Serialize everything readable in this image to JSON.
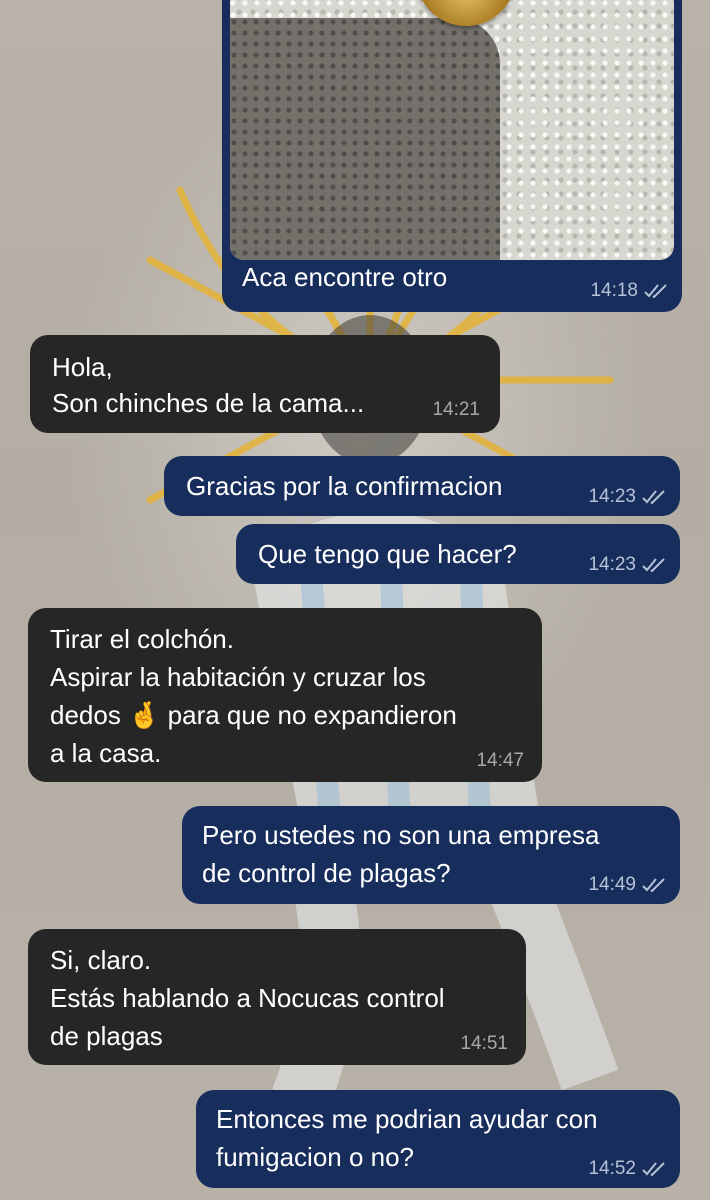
{
  "messages": [
    {
      "text": "Hola,\nSon chinches de la cama...",
      "time": "14:21"
    },
    {
      "text": "Gracias por la confirmacion",
      "time": "14:23"
    },
    {
      "text": "Que tengo que hacer?",
      "time": "14:23"
    },
    {
      "text": "Tirar el colchón.\nAspirar la habitación y cruzar los\ndedos 🤞 para que no expandieron\na la casa.",
      "time": "14:47"
    },
    {
      "text": "Pero ustedes no son una empresa\nde control de plagas?",
      "time": "14:49"
    },
    {
      "text": "Si, claro.\nEstás hablando a Nocucas control\nde plagas",
      "time": "14:51"
    },
    {
      "text": "Entonces me podrian ayudar con\nfumigacion o no?",
      "time": "14:52"
    }
  ],
  "image_message": {
    "caption": "Aca encontre otro",
    "time": "14:18"
  },
  "colors": {
    "incoming_bubble": "#262626",
    "outgoing_bubble": "#172d5c",
    "wallpaper": "#b4aea4",
    "sun": "#e3b53c"
  },
  "icons": [
    "double-check-icon",
    "crossed-fingers-emoji"
  ]
}
